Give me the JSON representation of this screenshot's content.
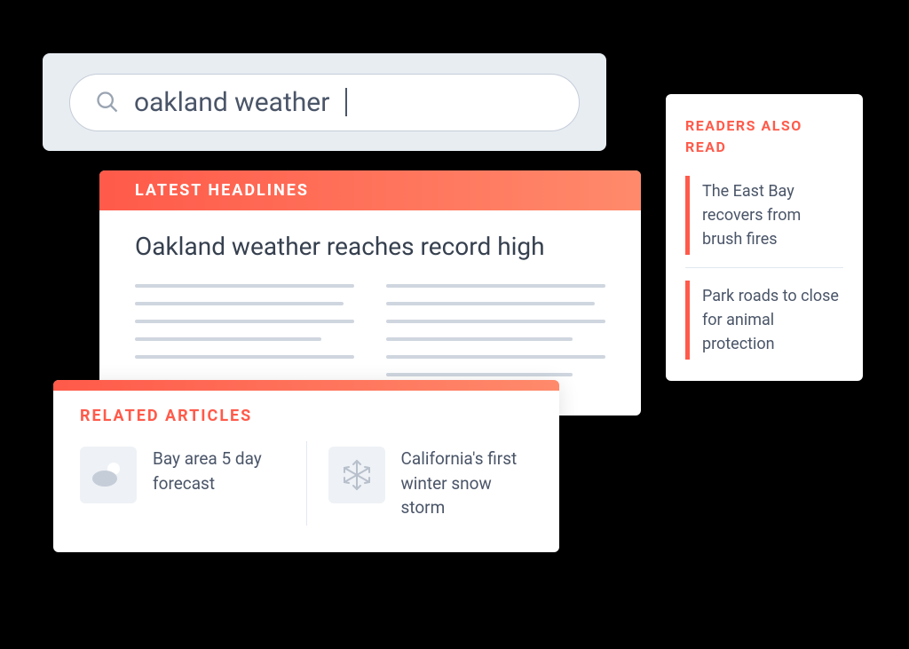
{
  "search": {
    "query": "oakland weather"
  },
  "headlines": {
    "section_label": "LATEST HEADLINES",
    "title": "Oakland weather reaches record high"
  },
  "related": {
    "section_label": "RELATED ARTICLES",
    "items": [
      {
        "title": "Bay area 5 day forecast",
        "icon": "weather-cloud-sun-icon"
      },
      {
        "title": "California's first winter snow storm",
        "icon": "snowflake-icon"
      }
    ]
  },
  "readers": {
    "section_label": "READERS ALSO READ",
    "items": [
      {
        "title": "The East Bay recovers from brush fires"
      },
      {
        "title": "Park roads to close for animal protection"
      }
    ]
  },
  "colors": {
    "accent": "#ff5a4a",
    "text": "#4a5568"
  }
}
